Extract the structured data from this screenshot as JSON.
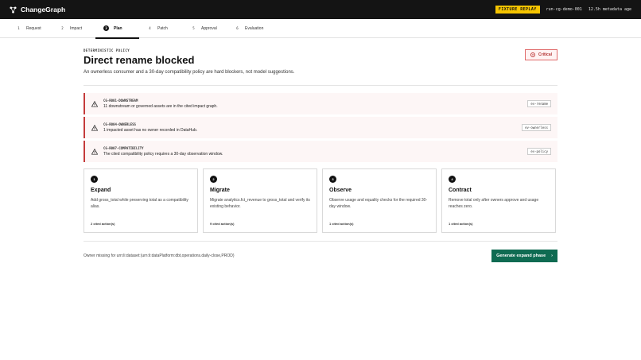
{
  "app": {
    "name": "ChangeGraph"
  },
  "topbar": {
    "replay_badge": "FIXTURE REPLAY",
    "run_id": "run-cg-demo-001",
    "metadata_age": "12.5h metadata age"
  },
  "steps": [
    {
      "num": "1",
      "label": "Request"
    },
    {
      "num": "2",
      "label": "Impact"
    },
    {
      "num": "3",
      "label": "Plan"
    },
    {
      "num": "4",
      "label": "Patch"
    },
    {
      "num": "5",
      "label": "Approval"
    },
    {
      "num": "6",
      "label": "Evaluation"
    }
  ],
  "header": {
    "kicker": "DETERMINISTIC POLICY",
    "title": "Direct rename blocked",
    "subtitle": "An ownerless consumer and a 30-day compatibility policy are hard blockers, not model suggestions.",
    "severity": "Critical"
  },
  "findings": [
    {
      "code": "CG-R001-DOWNSTREAM",
      "text": "11 downstream or governed assets are in the cited impact graph.",
      "tag": "ev-rename"
    },
    {
      "code": "CG-R004-OWNERLESS",
      "text": "1 impacted asset has no owner recorded in DataHub.",
      "tag": "ev-ownerless"
    },
    {
      "code": "CG-R007-COMPATIBILITY",
      "text": "The cited compatibility policy requires a 30-day observation window.",
      "tag": "ev-policy"
    }
  ],
  "cards": [
    {
      "num": "1",
      "title": "Expand",
      "desc": "Add gross_total while preserving total as a compatibility alias.",
      "foot": "2 cited action(s)"
    },
    {
      "num": "2",
      "title": "Migrate",
      "desc": "Migrate analytics.fct_revenue to gross_total and verify its existing behavior.",
      "foot": "9 cited action(s)"
    },
    {
      "num": "3",
      "title": "Observe",
      "desc": "Observe usage and equality checks for the required 30-day window.",
      "foot": "1 cited action(s)"
    },
    {
      "num": "4",
      "title": "Contract",
      "desc": "Remove total only after owners approve and usage reaches zero.",
      "foot": "1 cited action(s)"
    }
  ],
  "footer": {
    "owner_note": "Owner missing for urn:li:dataset:(urn:li:dataPlatform:dbt,operations.daily-close,PROD)",
    "generate_label": "Generate expand phase"
  },
  "colors": {
    "accent": "#0f6b52",
    "critical": "#c43b3b",
    "replay": "#f5c400"
  }
}
